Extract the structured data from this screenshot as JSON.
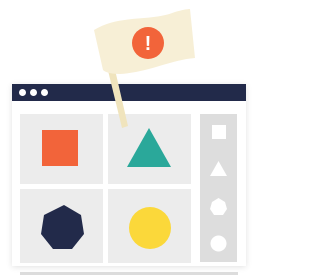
{
  "colors": {
    "titlebar": "#222a4a",
    "tile_bg": "#ececec",
    "sidebar_bg": "#dddddd",
    "square": "#f2643a",
    "triangle": "#2aa89a",
    "heptagon": "#222a4a",
    "circle": "#fbd83a",
    "flag": "#f7efd6",
    "flag_badge": "#f2643a",
    "pole": "#f0e4bd"
  },
  "window": {
    "controls": [
      "dot",
      "dot",
      "dot"
    ],
    "tiles": [
      {
        "shape": "square",
        "icon": "square-icon"
      },
      {
        "shape": "triangle",
        "icon": "triangle-icon"
      },
      {
        "shape": "heptagon",
        "icon": "heptagon-icon"
      },
      {
        "shape": "circle",
        "icon": "circle-icon"
      }
    ],
    "sidebar": [
      "square-outline-icon",
      "triangle-outline-icon",
      "heptagon-outline-icon",
      "circle-outline-icon"
    ]
  },
  "flag": {
    "badge_text": "!",
    "icon": "alert-icon"
  }
}
